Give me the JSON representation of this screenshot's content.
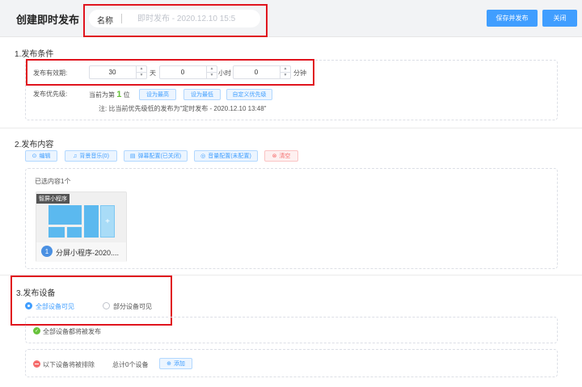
{
  "header": {
    "title": "创建即时发布",
    "name_label": "名称",
    "name_placeholder": "即时发布 - 2020.12.10 15:5",
    "save_publish_label": "保存并发布",
    "close_label": "关闭"
  },
  "conditions": {
    "title": "1.发布条件",
    "validity_label": "发布有效期:",
    "days_value": "30",
    "days_unit": "天",
    "hours_value": "0",
    "hours_unit": "小时",
    "minutes_value": "0",
    "minutes_unit": "分钟",
    "priority_label": "发布优先级:",
    "rank_prefix": "当前为第",
    "rank_value": "1",
    "rank_suffix": "位",
    "btn_highest": "设为最高",
    "btn_lowest": "设为最低",
    "btn_custom": "自定义优先级",
    "note": "注:  比当前优先级低的发布为\"定时发布 - 2020.12.10 13:48\""
  },
  "content": {
    "title": "2.发布内容",
    "btn_edit": "编辑",
    "btn_music": "背景音乐(0)",
    "btn_danmaku": "弹幕配置(已关闭)",
    "btn_volume": "音量配置(未配置)",
    "btn_clear": "清空",
    "selected_count": "已选内容1个",
    "card_tag": "智屏小程序",
    "card_index": "1",
    "card_name": "分屏小程序-2020...."
  },
  "devices": {
    "title": "3.发布设备",
    "option_all": "全部设备可见",
    "option_partial": "部分设备可见",
    "all_note": "全部设备都将被发布",
    "exclude_label": "以下设备将被排除",
    "exclude_count": "总计0个设备",
    "btn_add": "添加"
  },
  "colors": {
    "primary": "#409eff",
    "success": "#67c23a",
    "danger": "#f56c6c",
    "highlight": "#e0141e"
  }
}
